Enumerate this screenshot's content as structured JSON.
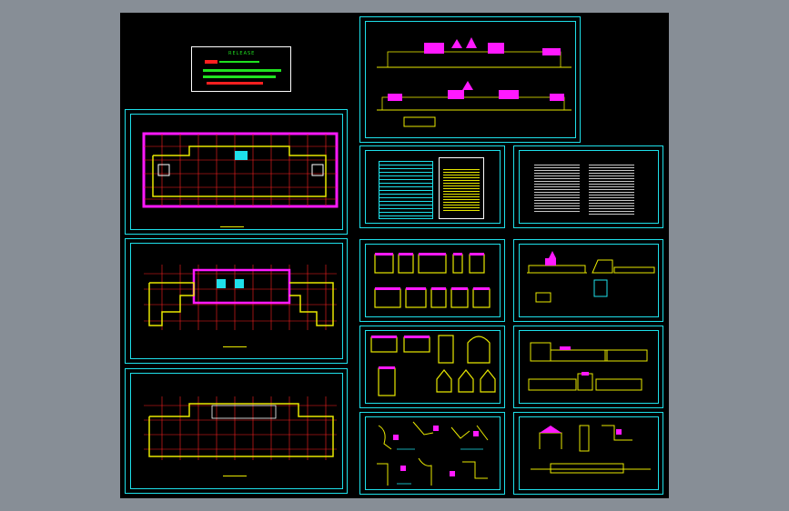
{
  "app": {
    "background": "#878e96",
    "drawing_bg": "#000000"
  },
  "colors": {
    "frame": "#1ee0ea",
    "wall": "#e8e800",
    "accent": "#ff19ff",
    "red": "#ff2020",
    "green": "#20e020"
  },
  "release_box": {
    "title": "RELEASE",
    "line1": "",
    "line2": ""
  },
  "sheets": {
    "plan1_caption": "",
    "plan2_caption": "",
    "plan3_caption": "",
    "elevation_caption": "",
    "table_title": "",
    "notes_title": "",
    "section_caption": ""
  }
}
